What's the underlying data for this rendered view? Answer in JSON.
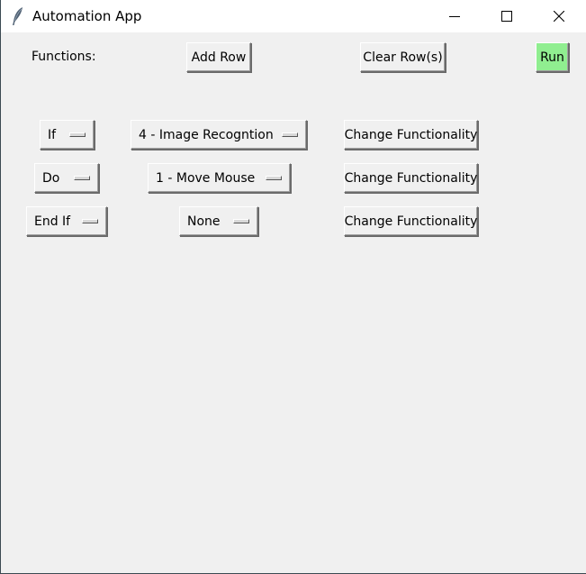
{
  "window": {
    "title": "Automation App",
    "icon": "feather-icon",
    "controls": [
      "minimize-icon",
      "maximize-icon",
      "close-icon"
    ]
  },
  "toolbar": {
    "functions_label": "Functions:",
    "add_row_label": "Add Row",
    "clear_rows_label": "Clear Row(s)",
    "run_label": "Run",
    "run_color": "#90ee90"
  },
  "rows": [
    {
      "type": "If",
      "function": "4 - Image Recogntion",
      "change_label": "Change Functionality"
    },
    {
      "type": "Do",
      "function": "1 - Move Mouse",
      "change_label": "Change Functionality"
    },
    {
      "type": "End If",
      "function": "None",
      "change_label": "Change Functionality"
    }
  ]
}
